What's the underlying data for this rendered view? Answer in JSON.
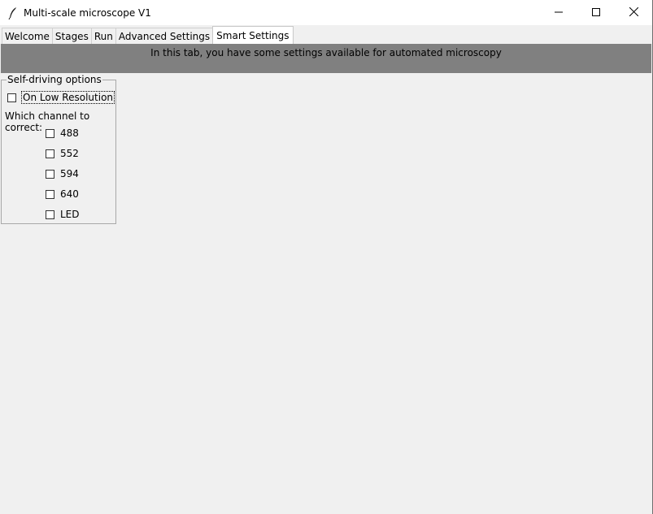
{
  "window": {
    "title": "Multi-scale microscope V1",
    "icon": "feather-icon",
    "controls": [
      "minimize-icon",
      "maximize-icon",
      "close-icon"
    ]
  },
  "tabs": [
    {
      "label": "Welcome",
      "active": false
    },
    {
      "label": "Stages",
      "active": false
    },
    {
      "label": "Run",
      "active": false
    },
    {
      "label": "Advanced Settings",
      "active": false
    },
    {
      "label": "Smart Settings",
      "active": true
    }
  ],
  "banner": {
    "text": "In this tab, you have some settings available for automated microscopy"
  },
  "self_driving": {
    "legend": "Self-driving options",
    "low_res": {
      "label": "On Low Resolution",
      "checked": false
    },
    "channel_prompt": "Which channel to correct:",
    "channels": [
      {
        "label": "488",
        "checked": false
      },
      {
        "label": "552",
        "checked": false
      },
      {
        "label": "594",
        "checked": false
      },
      {
        "label": "640",
        "checked": false
      },
      {
        "label": "LED",
        "checked": false
      }
    ]
  },
  "colors": {
    "banner_bg": "#808080",
    "window_bg": "#f0f0f0",
    "titlebar_bg": "#ffffff"
  }
}
